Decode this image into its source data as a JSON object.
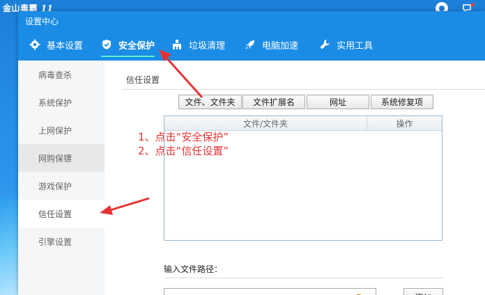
{
  "background_app": {
    "logo_text": "金山毒霸",
    "logo_version": "11"
  },
  "dialog": {
    "title": "设置中心",
    "tabs": [
      {
        "label": "基本设置",
        "icon": "gear-icon"
      },
      {
        "label": "安全保护",
        "icon": "shield-icon",
        "active": true
      },
      {
        "label": "垃圾清理",
        "icon": "broom-icon"
      },
      {
        "label": "电脑加速",
        "icon": "rocket-icon"
      },
      {
        "label": "实用工具",
        "icon": "wrench-icon"
      }
    ],
    "sidebar": [
      {
        "label": "病毒查杀"
      },
      {
        "label": "系统保护"
      },
      {
        "label": "上网保护"
      },
      {
        "label": "网购保镖",
        "state": "hover"
      },
      {
        "label": "游戏保护"
      },
      {
        "label": "信任设置",
        "state": "active"
      },
      {
        "label": "引擎设置"
      }
    ],
    "section_title": "信任设置",
    "filter_buttons": [
      "文件、文件夹",
      "文件扩展名",
      "网址",
      "系统修复项"
    ],
    "table_headers": [
      "文件/文件夹",
      "操作"
    ],
    "path_label": "输入文件路径：",
    "path_value": "",
    "add_button": "添加"
  },
  "annotation": {
    "line1": "1、点击“安全保护”",
    "line2": "2、点击“信任设置”"
  },
  "colors": {
    "header_blue": "#1a8ce6",
    "active_underline": "#5ff0c9",
    "annotation_red": "#e53333"
  }
}
